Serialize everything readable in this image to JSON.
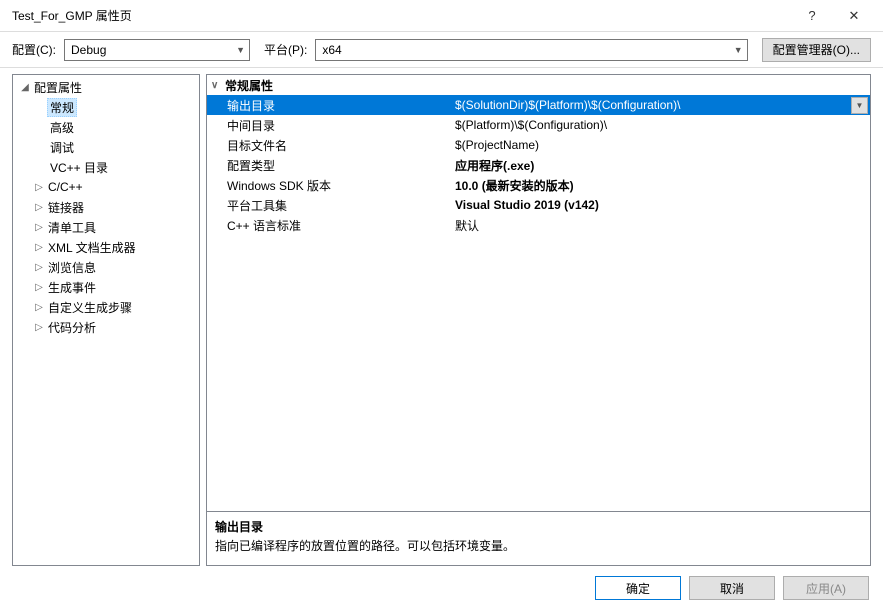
{
  "window": {
    "title": "Test_For_GMP 属性页",
    "help": "?",
    "close": "✕"
  },
  "toolbar": {
    "config_label": "配置(C):",
    "config_value": "Debug",
    "platform_label": "平台(P):",
    "platform_value": "x64",
    "config_mgr": "配置管理器(O)..."
  },
  "tree": {
    "root": "配置属性",
    "children": [
      "常规",
      "高级",
      "调试",
      "VC++ 目录"
    ],
    "collapsed": [
      "C/C++",
      "链接器",
      "清单工具",
      "XML 文档生成器",
      "浏览信息",
      "生成事件",
      "自定义生成步骤",
      "代码分析"
    ]
  },
  "grid": {
    "group": "常规属性",
    "rows": [
      {
        "k": "输出目录",
        "v": "$(SolutionDir)$(Platform)\\$(Configuration)\\",
        "sel": true
      },
      {
        "k": "中间目录",
        "v": "$(Platform)\\$(Configuration)\\"
      },
      {
        "k": "目标文件名",
        "v": "$(ProjectName)"
      },
      {
        "k": "配置类型",
        "v": "应用程序(.exe)",
        "bold": true
      },
      {
        "k": "Windows SDK 版本",
        "v": "10.0 (最新安装的版本)",
        "bold": true
      },
      {
        "k": "平台工具集",
        "v": "Visual Studio 2019 (v142)",
        "bold": true
      },
      {
        "k": "C++ 语言标准",
        "v": "默认"
      }
    ]
  },
  "desc": {
    "title": "输出目录",
    "text": "指向已编译程序的放置位置的路径。可以包括环境变量。"
  },
  "footer": {
    "ok": "确定",
    "cancel": "取消",
    "apply": "应用(A)"
  }
}
